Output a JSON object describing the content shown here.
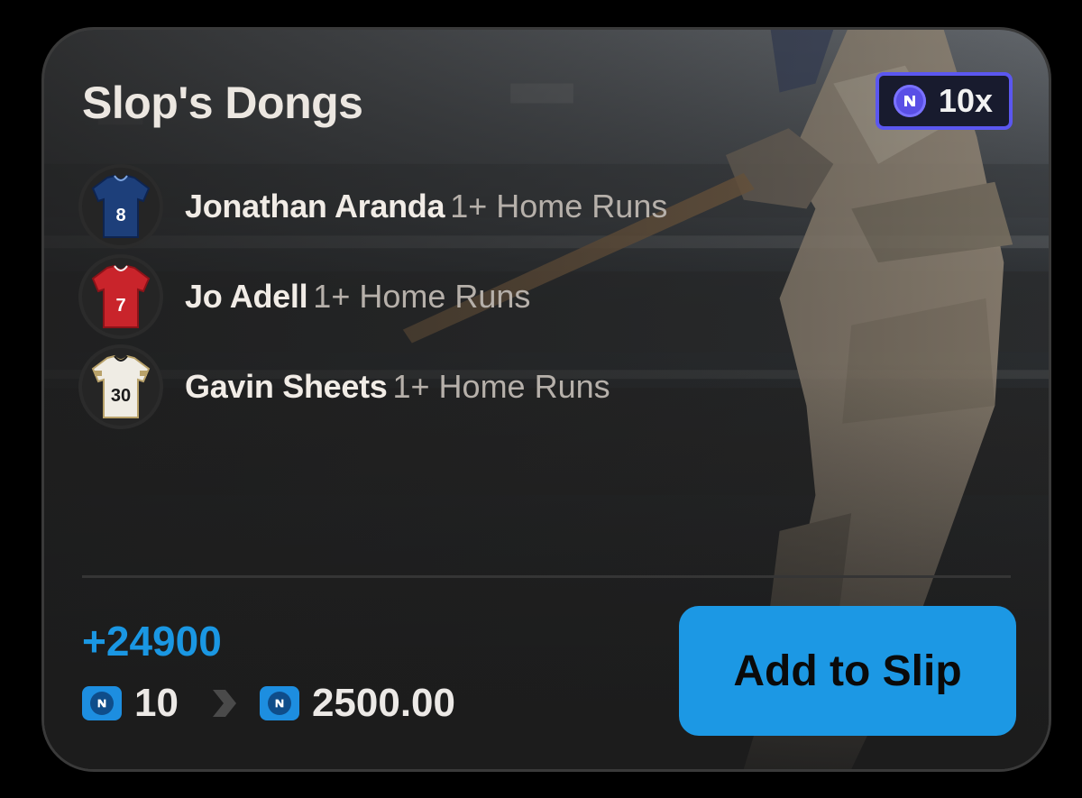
{
  "card": {
    "title": "Slop's Dongs",
    "multiplier": {
      "icon": "n-coin-icon",
      "label": "10x",
      "color": "#5b57f0"
    },
    "legs": [
      {
        "player": "Jonathan Aranda",
        "market": "1+ Home Runs",
        "jersey": {
          "number": "8",
          "color": "#1d3f7a",
          "trim": "#0e2450",
          "num_color": "#ffffff"
        }
      },
      {
        "player": "Jo Adell",
        "market": "1+ Home Runs",
        "jersey": {
          "number": "7",
          "color": "#c9242b",
          "trim": "#8c1218",
          "num_color": "#ffffff"
        }
      },
      {
        "player": "Gavin Sheets",
        "market": "1+ Home Runs",
        "jersey": {
          "number": "30",
          "color": "#efece4",
          "trim": "#b9a26a",
          "num_color": "#1b1b1b"
        }
      }
    ],
    "odds": "+24900",
    "stake": {
      "icon": "token-icon",
      "value": "10"
    },
    "payout": {
      "icon": "token-icon",
      "value": "2500.00"
    },
    "add_button": "Add to Slip",
    "accent": "#1a97e3"
  }
}
